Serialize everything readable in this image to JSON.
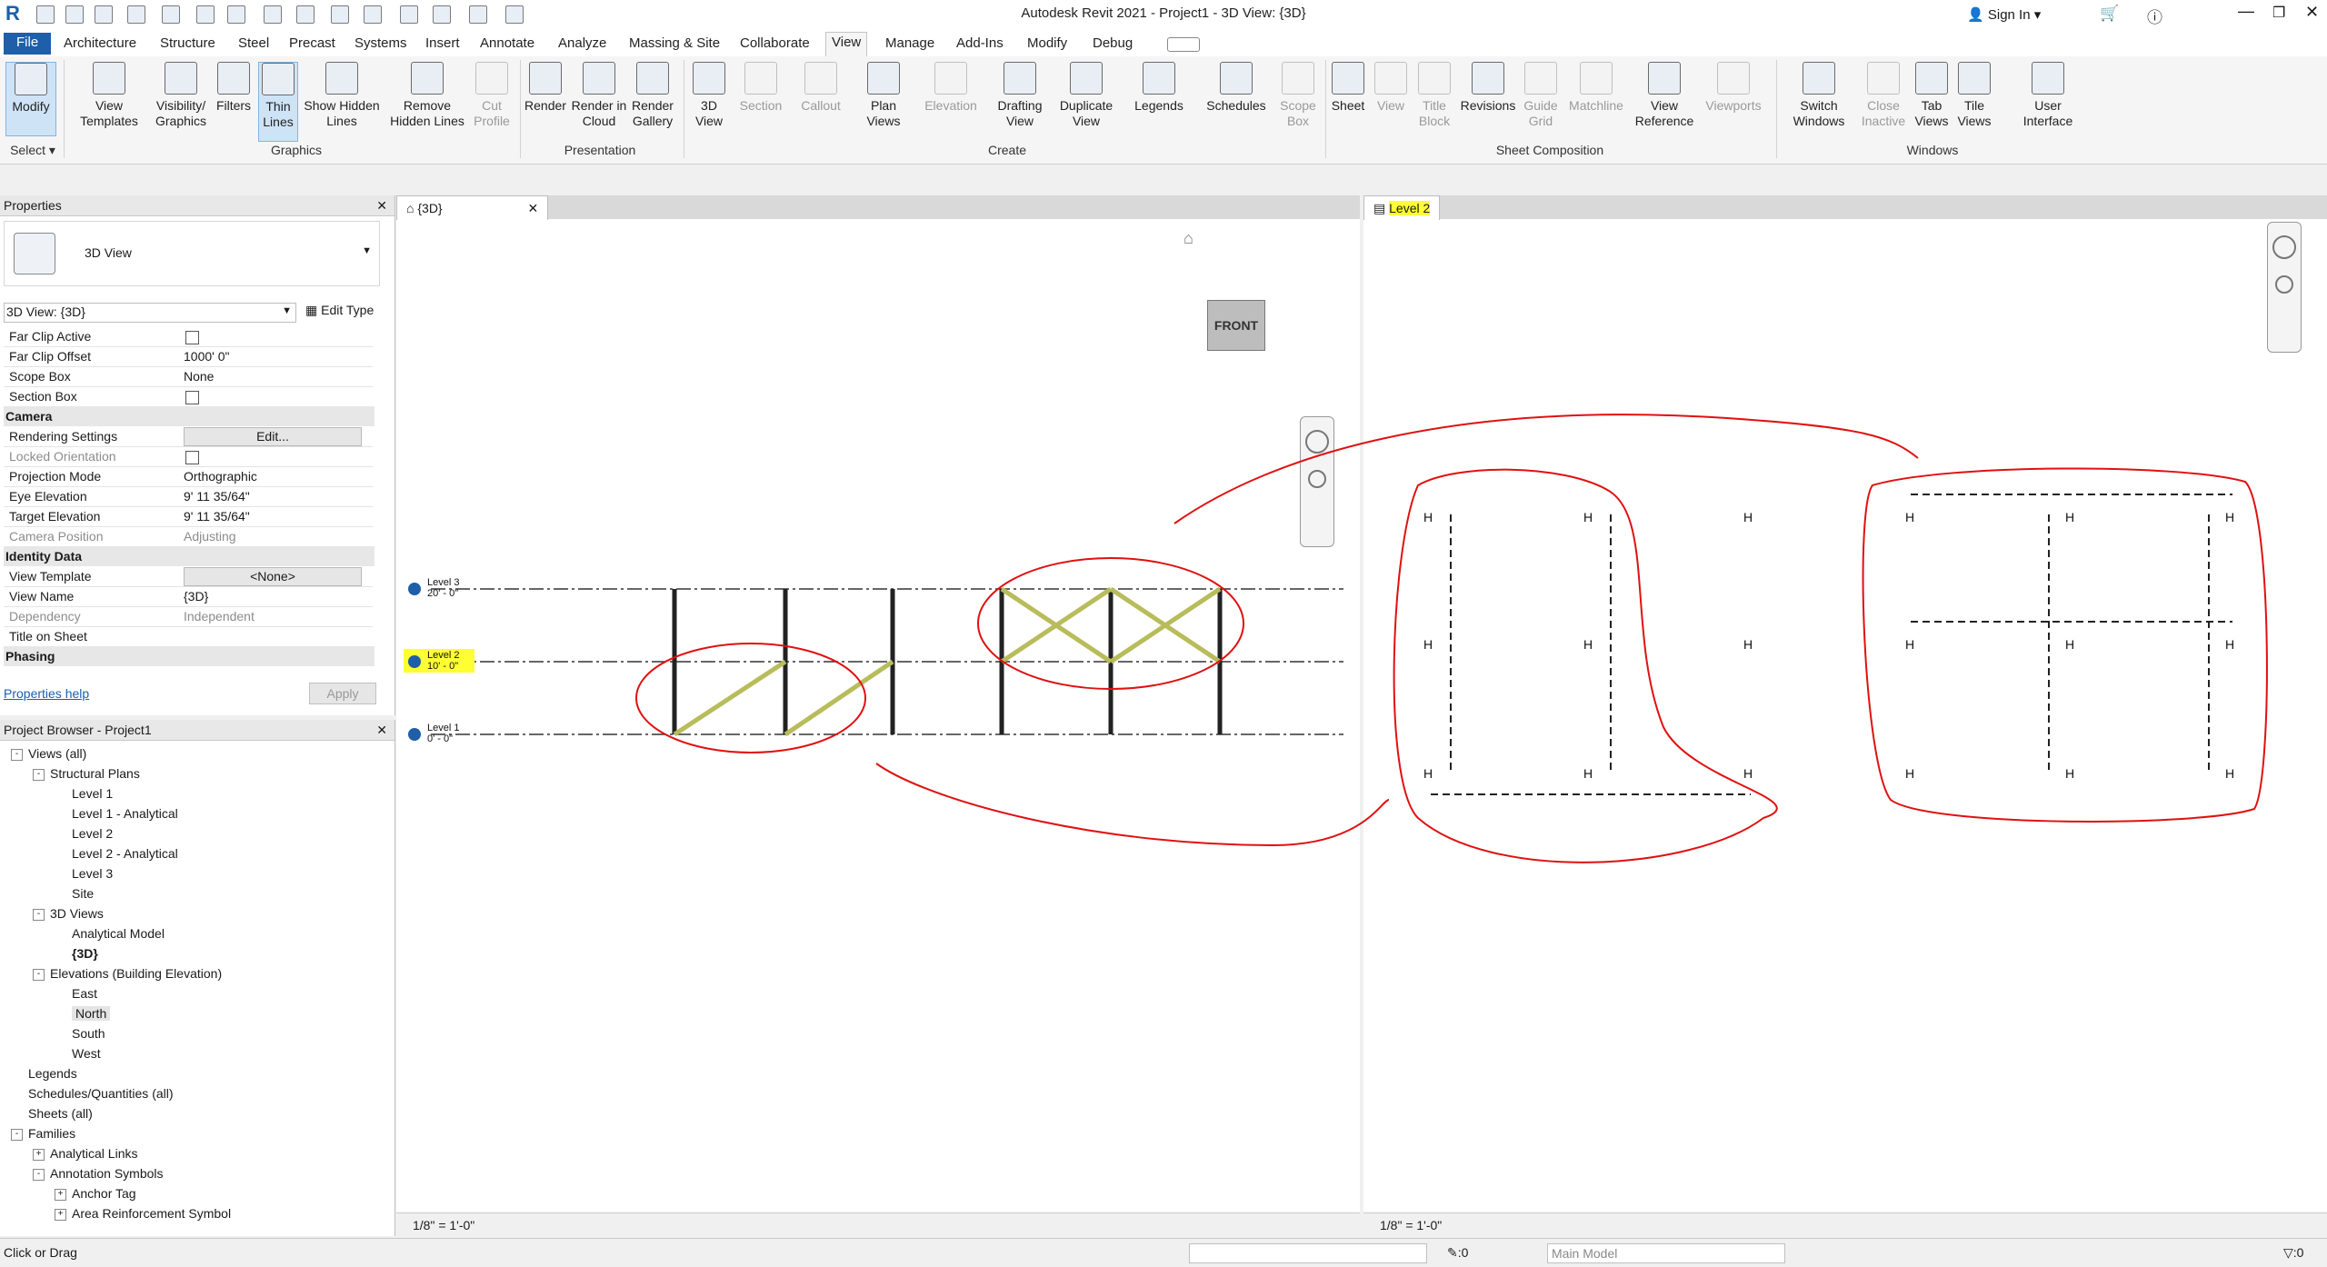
{
  "app": {
    "title": "Autodesk Revit 2021 - Project1 - 3D View: {3D}",
    "sign_in": "Sign In"
  },
  "menu_tabs": [
    "File",
    "Architecture",
    "Structure",
    "Steel",
    "Precast",
    "Systems",
    "Insert",
    "Annotate",
    "Analyze",
    "Massing & Site",
    "Collaborate",
    "View",
    "Manage",
    "Add-Ins",
    "Modify",
    "Debug"
  ],
  "ribbon": {
    "select": {
      "modify": "Modify",
      "select_label": "Select"
    },
    "graphics": {
      "items": [
        "View Templates",
        "Visibility/ Graphics",
        "Filters",
        "Thin Lines",
        "Show Hidden Lines",
        "Remove Hidden Lines",
        "Cut Profile"
      ],
      "label": "Graphics"
    },
    "presentation": {
      "items": [
        "Render",
        "Render in Cloud",
        "Render Gallery"
      ],
      "label": "Presentation"
    },
    "create": {
      "items": [
        "3D View",
        "Section",
        "Callout",
        "Plan Views",
        "Elevation",
        "Drafting View",
        "Duplicate View",
        "Legends",
        "Schedules",
        "Scope Box"
      ],
      "label": "Create"
    },
    "sheet": {
      "items": [
        "Sheet",
        "View",
        "Title Block",
        "Revisions",
        "Guide Grid",
        "Matchline",
        "View Reference",
        "Viewports"
      ],
      "label": "Sheet Composition"
    },
    "windows": {
      "items": [
        "Switch Windows",
        "Close Inactive",
        "Tab Views",
        "Tile Views",
        "User Interface"
      ],
      "label": "Windows"
    }
  },
  "properties": {
    "title": "Properties",
    "type_name": "3D View",
    "instance_selector": "3D View: {3D}",
    "edit_type": "Edit Type",
    "rows_top": [
      {
        "k": "Far Clip Active",
        "v": ""
      },
      {
        "k": "Far Clip Offset",
        "v": "1000'  0\""
      },
      {
        "k": "Scope Box",
        "v": "None"
      },
      {
        "k": "Section Box",
        "v": ""
      }
    ],
    "camera_label": "Camera",
    "camera_rows": [
      {
        "k": "Rendering Settings",
        "v": "Edit..."
      },
      {
        "k": "Locked Orientation",
        "v": ""
      },
      {
        "k": "Projection Mode",
        "v": "Orthographic"
      },
      {
        "k": "Eye Elevation",
        "v": "9'  11 35/64\""
      },
      {
        "k": "Target Elevation",
        "v": "9'  11 35/64\""
      },
      {
        "k": "Camera Position",
        "v": "Adjusting"
      }
    ],
    "identity_label": "Identity Data",
    "identity_rows": [
      {
        "k": "View Template",
        "v": "<None>"
      },
      {
        "k": "View Name",
        "v": "{3D}"
      },
      {
        "k": "Dependency",
        "v": "Independent"
      },
      {
        "k": "Title on Sheet",
        "v": ""
      }
    ],
    "phasing_label": "Phasing",
    "help_link": "Properties help",
    "apply": "Apply"
  },
  "browser": {
    "title": "Project Browser - Project1",
    "items": [
      {
        "t": "Views (all)",
        "lvl": 0,
        "tog": "-"
      },
      {
        "t": "Structural Plans",
        "lvl": 1,
        "tog": "-"
      },
      {
        "t": "Level 1",
        "lvl": 2
      },
      {
        "t": "Level 1 - Analytical",
        "lvl": 2
      },
      {
        "t": "Level 2",
        "lvl": 2
      },
      {
        "t": "Level 2 - Analytical",
        "lvl": 2
      },
      {
        "t": "Level 3",
        "lvl": 2
      },
      {
        "t": "Site",
        "lvl": 2
      },
      {
        "t": "3D Views",
        "lvl": 1,
        "tog": "-"
      },
      {
        "t": "Analytical Model",
        "lvl": 2
      },
      {
        "t": "{3D}",
        "lvl": 2,
        "bold": true
      },
      {
        "t": "Elevations (Building Elevation)",
        "lvl": 1,
        "tog": "-"
      },
      {
        "t": "East",
        "lvl": 2
      },
      {
        "t": "North",
        "lvl": 2,
        "sel": true
      },
      {
        "t": "South",
        "lvl": 2
      },
      {
        "t": "West",
        "lvl": 2
      },
      {
        "t": "Legends",
        "lvl": 0
      },
      {
        "t": "Schedules/Quantities (all)",
        "lvl": 0
      },
      {
        "t": "Sheets (all)",
        "lvl": 0
      },
      {
        "t": "Families",
        "lvl": 0,
        "tog": "-"
      },
      {
        "t": "Analytical Links",
        "lvl": 1,
        "tog": "+"
      },
      {
        "t": "Annotation Symbols",
        "lvl": 1,
        "tog": "-"
      },
      {
        "t": "Anchor Tag",
        "lvl": 2,
        "tog": "+"
      },
      {
        "t": "Area Reinforcement Symbol",
        "lvl": 2,
        "tog": "+"
      }
    ]
  },
  "view3d": {
    "tab": "{3D}",
    "viewcube": "FRONT",
    "levels": [
      {
        "name": "Level 3",
        "elev": "20' - 0\""
      },
      {
        "name": "Level 2",
        "elev": "10' - 0\""
      },
      {
        "name": "Level 1",
        "elev": "0' - 0\""
      }
    ],
    "scale": "1/8\" = 1'-0\""
  },
  "viewL2": {
    "tab": "Level 2",
    "scale": "1/8\" = 1'-0\""
  },
  "status": {
    "left": "Click or Drag",
    "filter_count": ":0",
    "model": "Main Model",
    "workset_count": ":0"
  },
  "colors": {
    "accent": "#1f5ea8",
    "highlight": "#ffff33",
    "annotation": "#e01010"
  }
}
